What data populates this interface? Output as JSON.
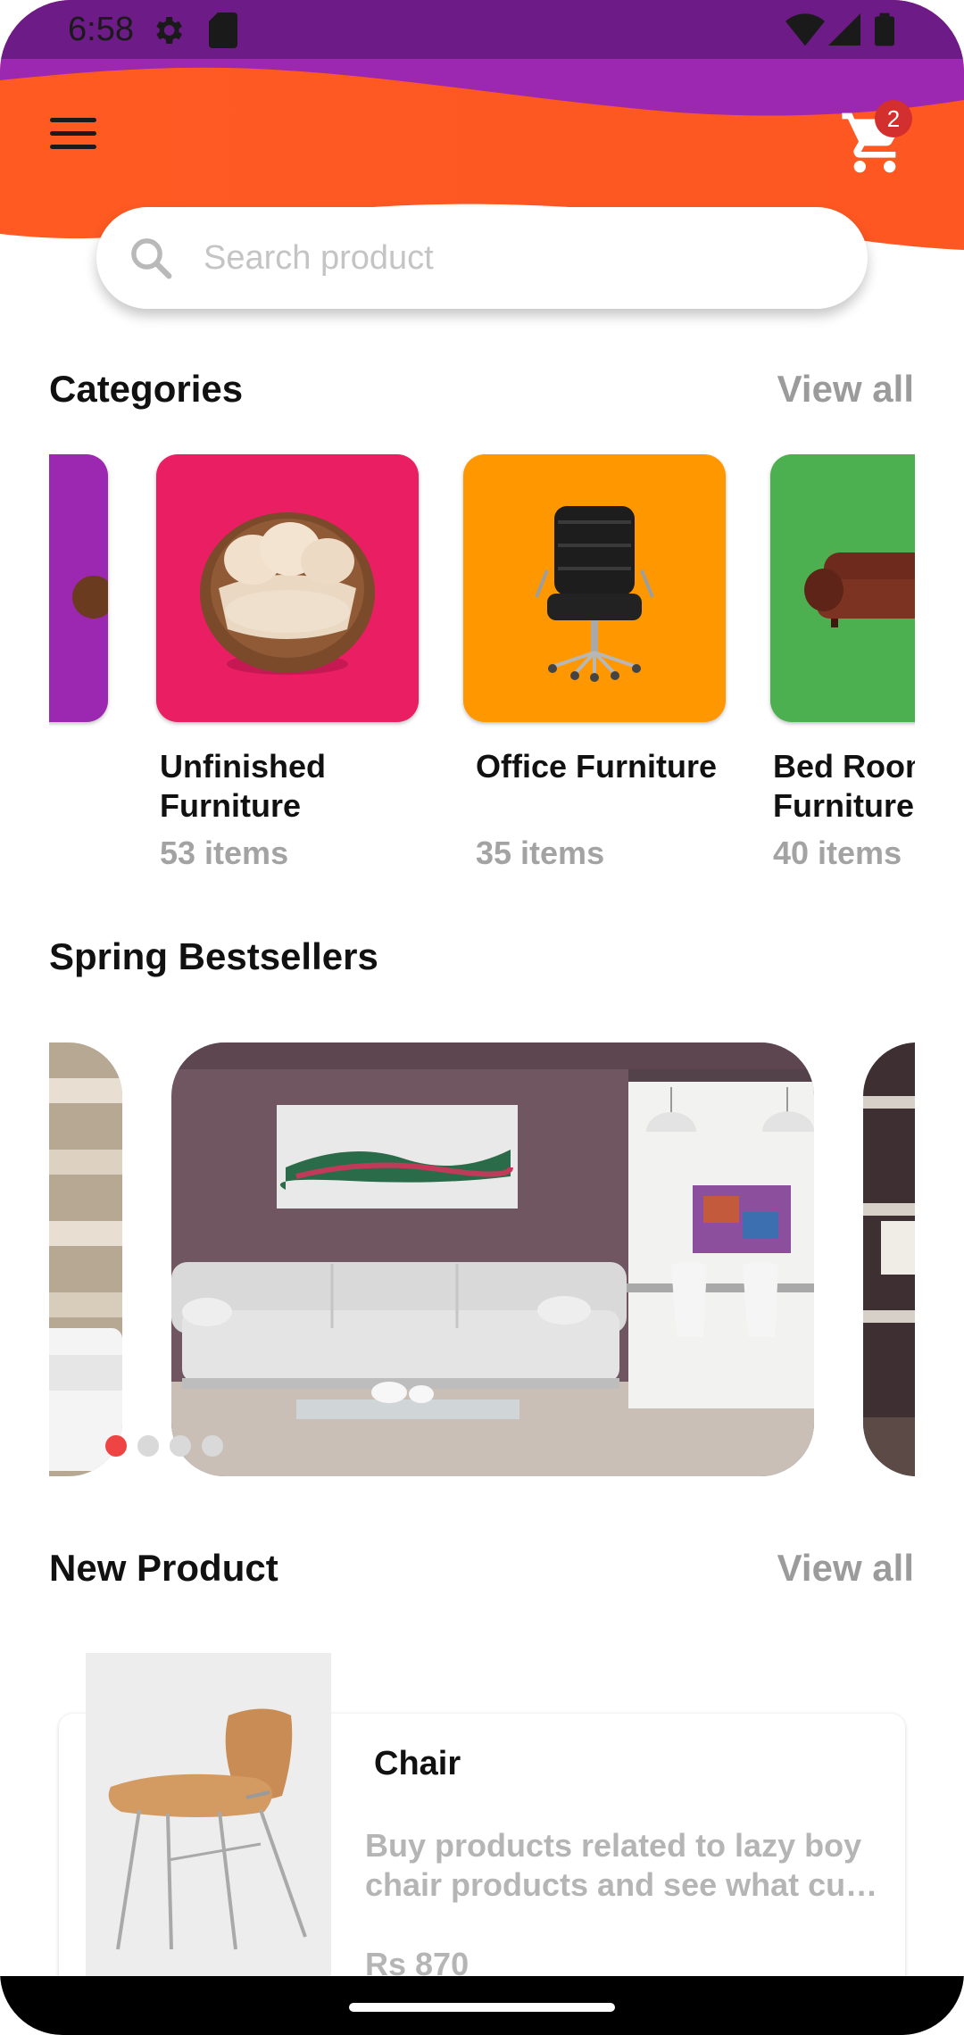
{
  "status_bar": {
    "time": "6:58",
    "icons": [
      "settings-icon",
      "sd-card-icon",
      "wifi-icon",
      "signal-icon",
      "battery-icon"
    ]
  },
  "header": {
    "cart_count": "2",
    "colors": {
      "orange": "#fe5722",
      "purple": "#9c27b0",
      "status": "#6d1b86"
    }
  },
  "search": {
    "placeholder": "Search product"
  },
  "categories": {
    "title": "Categories",
    "view_all": "View all",
    "items": [
      {
        "line1": "Unfinished",
        "line2": "Furniture",
        "count": "53 items",
        "color": "#e91e63"
      },
      {
        "line1": "Office Furniture",
        "line2": "",
        "count": "35 items",
        "color": "#ff9800"
      },
      {
        "line1": "Bed Room",
        "line2": "Furniture",
        "count": "40 items",
        "color": "#4caf50"
      }
    ],
    "partial_color": "#9c27b0"
  },
  "bestsellers": {
    "title": "Spring Bestsellers",
    "active_slide": 0,
    "slide_count": 4
  },
  "new_product": {
    "title": "New Product",
    "view_all": "View all",
    "item": {
      "name": "Chair",
      "desc_line1": "Buy products related to lazy boy",
      "desc_line2": "chair products and see what cu…",
      "price": "Rs 870"
    }
  }
}
